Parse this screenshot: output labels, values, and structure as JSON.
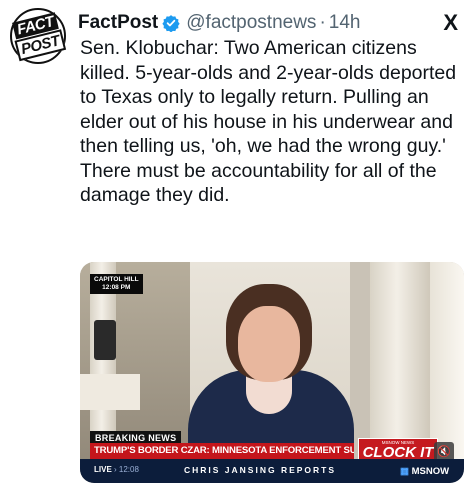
{
  "tweet": {
    "avatar_logo": {
      "line1": "FACT",
      "line2": "POST"
    },
    "display_name": "FactPost",
    "verified_icon": "verified-badge-icon",
    "handle": "@factpostnews",
    "separator": "·",
    "time": "14h",
    "platform_logo": "X",
    "text": "Sen. Klobuchar: Two American citizens killed. 5-year-olds and 2-year-olds deported to Texas only to legally return. Pulling an elder out of his house in his underwear and then telling us, 'oh, we had the wrong guy.' There must be accountability for all of the damage they did.",
    "colors": {
      "verified": "#1d9bf0",
      "text": "#0f1419",
      "muted": "#536471"
    }
  },
  "video": {
    "location_bug": {
      "line1": "CAPITOL HILL",
      "line2": "12:08 PM"
    },
    "breaking_label": "BREAKING NEWS",
    "headline": "TRUMP'S BORDER CZAR: MINNESOTA ENFORCEMENT SURGE IS ENDING",
    "live_label": "LIVE",
    "live_time": "12:08",
    "show_name": "CHRIS JANSING REPORTS",
    "promo_top": "MSNOW NEWS",
    "promo_text": "CLOCK IT",
    "network": "MSNOW",
    "mute_icon": "speaker-muted-icon",
    "colors": {
      "headline_bar": "#c4151b",
      "ticker": "#0c1d3b",
      "promo": "#c51a1f"
    }
  }
}
